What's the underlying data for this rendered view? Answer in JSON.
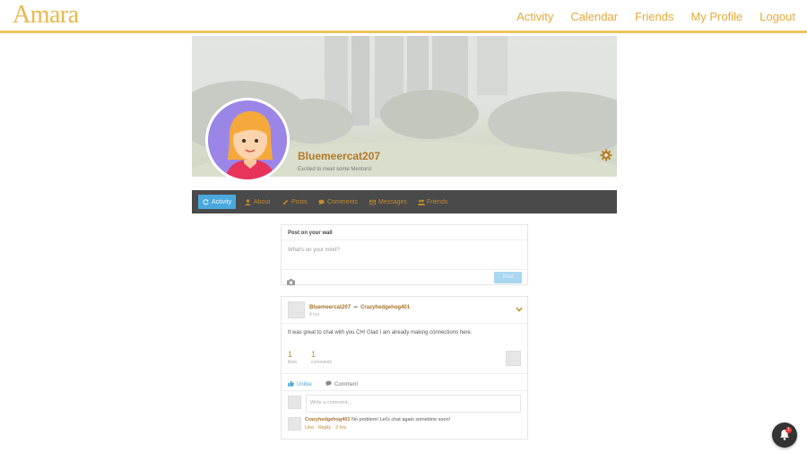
{
  "app": {
    "logo": "Amara"
  },
  "nav": [
    {
      "label": "Activity"
    },
    {
      "label": "Calendar"
    },
    {
      "label": "Friends"
    },
    {
      "label": "My Profile"
    },
    {
      "label": "Logout"
    }
  ],
  "profile": {
    "username": "Bluemeercat207",
    "tagline": "Excited to meet some Mentors!"
  },
  "tabs": [
    {
      "label": "Activity",
      "icon": "refresh-icon",
      "active": true
    },
    {
      "label": "About",
      "icon": "user-icon"
    },
    {
      "label": "Posts",
      "icon": "pencil-icon"
    },
    {
      "label": "Comments",
      "icon": "comment-icon"
    },
    {
      "label": "Messages",
      "icon": "envelope-icon"
    },
    {
      "label": "Friends",
      "icon": "users-icon"
    }
  ],
  "postbox": {
    "title": "Post on your wall",
    "placeholder": "What's on your mind?",
    "post_label": "Post"
  },
  "activity": {
    "author": "Bluemeercat207",
    "arrow": "➡",
    "recipient": "Crazyhedgehog401",
    "time": "4 hrs",
    "text": "It was great to chat with you CH! Glad I am already making connections here.",
    "likes_count": "1",
    "likes_label": "likes",
    "comments_count": "1",
    "comments_label": "comments",
    "unlike_label": "Unlike",
    "comment_label": "Comment",
    "comment_placeholder": "Write a comment...",
    "comment": {
      "author": "Crazyhedgehog401",
      "text": "No problem! Let's chat again sometime soon!",
      "like": "Like",
      "reply": "Reply",
      "time": "2 hrs",
      "sep": "·"
    }
  },
  "notifications": {
    "count": "1"
  },
  "colors": {
    "accent": "#e6a93a",
    "nav_border": "#f0c45c",
    "tab_active": "#4aa9dc",
    "tabs_bg": "#4a4a4a"
  }
}
